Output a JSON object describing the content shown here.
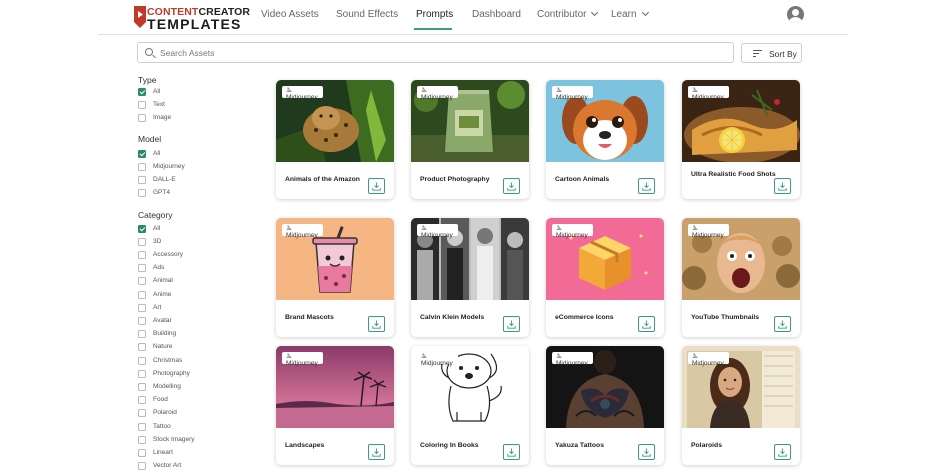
{
  "brand": {
    "logo_top_red": "CONTENT",
    "logo_top_dark": "CREATOR",
    "logo_bottom": "TEMPLATES",
    "accent_color": "#3a9e7e",
    "brand_red": "#c0392b"
  },
  "nav": {
    "items": [
      {
        "label": "Video Assets"
      },
      {
        "label": "Sound Effects"
      },
      {
        "label": "Prompts",
        "active": true
      },
      {
        "label": "Dashboard"
      },
      {
        "label": "Contributor",
        "dropdown": true
      },
      {
        "label": "Learn",
        "dropdown": true
      }
    ],
    "avatar_icon": "user-circle-icon"
  },
  "search": {
    "placeholder": "Search Assets",
    "value": "",
    "icon": "search-icon"
  },
  "sort": {
    "label": "Sort By",
    "icon": "sort-lines-icon"
  },
  "filters": [
    {
      "title": "Type",
      "options": [
        {
          "label": "All",
          "checked": true
        },
        {
          "label": "Text",
          "checked": false
        },
        {
          "label": "Image",
          "checked": false
        }
      ]
    },
    {
      "title": "Model",
      "options": [
        {
          "label": "All",
          "checked": true
        },
        {
          "label": "Midjourney",
          "checked": false
        },
        {
          "label": "DALL-E",
          "checked": false
        },
        {
          "label": "GPT4",
          "checked": false
        }
      ]
    },
    {
      "title": "Category",
      "options": [
        {
          "label": "All",
          "checked": true
        },
        {
          "label": "3D",
          "checked": false
        },
        {
          "label": "Accessory",
          "checked": false
        },
        {
          "label": "Ads",
          "checked": false
        },
        {
          "label": "Animal",
          "checked": false
        },
        {
          "label": "Anime",
          "checked": false
        },
        {
          "label": "Art",
          "checked": false
        },
        {
          "label": "Avatar",
          "checked": false
        },
        {
          "label": "Building",
          "checked": false
        },
        {
          "label": "Nature",
          "checked": false
        },
        {
          "label": "Christmas",
          "checked": false
        },
        {
          "label": "Photography",
          "checked": false
        },
        {
          "label": "Modelling",
          "checked": false
        },
        {
          "label": "Food",
          "checked": false
        },
        {
          "label": "Polaroid",
          "checked": false
        },
        {
          "label": "Tattoo",
          "checked": false
        },
        {
          "label": "Stock Imagery",
          "checked": false
        },
        {
          "label": "Lineart",
          "checked": false
        },
        {
          "label": "Vector Art",
          "checked": false
        }
      ]
    }
  ],
  "cards": [
    {
      "title": "Animals of the Amazon",
      "badge": "Midjourney",
      "image": "jaguar-in-jungle"
    },
    {
      "title": "Product Photography",
      "badge": "Midjourney",
      "image": "green-pouch-product"
    },
    {
      "title": "Cartoon Animals",
      "badge": "Midjourney",
      "image": "cartoon-puppy"
    },
    {
      "title": "Ultra Realistic Food Shots",
      "badge": "Midjourney",
      "image": "grilled-fish-with-lemon"
    },
    {
      "title": "Brand Mascots",
      "badge": "Midjourney",
      "image": "bubble-tea-mascot"
    },
    {
      "title": "Calvin Klein Models",
      "badge": "Midjourney",
      "image": "black-and-white-models"
    },
    {
      "title": "eCommerce Icons",
      "badge": "Midjourney",
      "image": "cardboard-box-icon"
    },
    {
      "title": "YouTube Thumbnails",
      "badge": "Midjourney",
      "image": "shocked-face-thumbnail"
    },
    {
      "title": "Landscapes",
      "badge": "Midjourney",
      "image": "pink-sunset-beach"
    },
    {
      "title": "Coloring In Books",
      "badge": "Midjourney",
      "image": "puppy-line-drawing"
    },
    {
      "title": "Yakuza Tattoos",
      "badge": "Midjourney",
      "image": "back-tattoo"
    },
    {
      "title": "Polaroids",
      "badge": "Midjourney",
      "image": "woman-portrait"
    }
  ],
  "card_action_icon": "download-icon"
}
